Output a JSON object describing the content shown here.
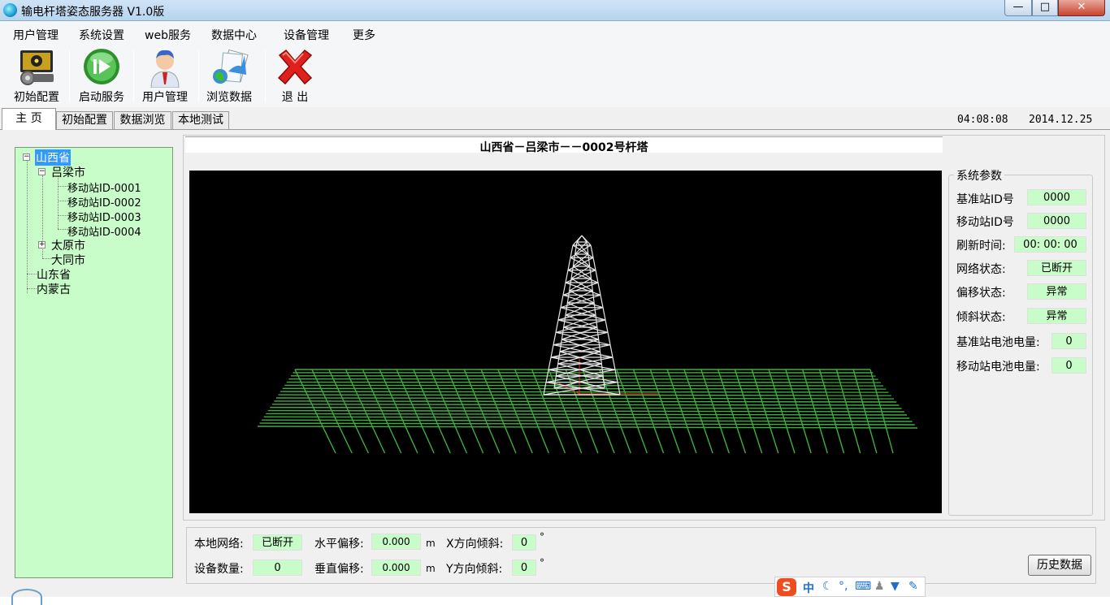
{
  "window": {
    "title": "输电杆塔姿态服务器  V1.0版",
    "controls": {
      "minimize": "—",
      "maximize": "□",
      "close": "✕"
    }
  },
  "menu": [
    "用户管理",
    "系统设置",
    "web服务",
    "数据中心",
    "设备管理",
    "更多"
  ],
  "toolbar": [
    {
      "label": "初始配置",
      "icon": "monitor-gear-icon"
    },
    {
      "label": "启动服务",
      "icon": "play-circle-icon"
    },
    {
      "label": "用户管理",
      "icon": "user-avatar-icon"
    },
    {
      "label": "浏览数据",
      "icon": "browse-document-icon"
    },
    {
      "label": "退 出",
      "icon": "red-x-exit-icon"
    }
  ],
  "tabs": [
    "主 页",
    "初始配置",
    "数据浏览",
    "本地测试"
  ],
  "clock": "04:08:08",
  "date": "2014.12.25",
  "tree": {
    "root": "山西省",
    "city1": "吕梁市",
    "stations": [
      "移动站ID-0001",
      "移动站ID-0002",
      "移动站ID-0003",
      "移动站ID-0004"
    ],
    "city2": "太原市",
    "city3": "大同市",
    "province2": "山东省",
    "province3": "内蒙古"
  },
  "viewer": {
    "title": "山西省－吕梁市－－0002号杆塔",
    "colors": {
      "background": "#000000",
      "grid": "#3fae3f",
      "tower": "#e6e6e6",
      "axis": "#cc2a2a"
    }
  },
  "params": {
    "legend": "系统参数",
    "rows": [
      {
        "label": "基准站ID号",
        "value": "0000"
      },
      {
        "label": "移动站ID号",
        "value": "0000"
      },
      {
        "label": "刷新时间:",
        "value": "00: 00: 00"
      },
      {
        "label": "网络状态:",
        "value": "已断开"
      },
      {
        "label": "偏移状态:",
        "value": "异常"
      },
      {
        "label": "倾斜状态:",
        "value": "异常"
      },
      {
        "label": "基准站电池电量:",
        "value": "0"
      },
      {
        "label": "移动站电池电量:",
        "value": "0"
      }
    ]
  },
  "status": {
    "network_label": "本地网络:",
    "network_value": "已断开",
    "devices_label": "设备数量:",
    "devices_value": "0",
    "hshift_label": "水平偏移:",
    "hshift_value": "0.000",
    "hshift_unit": "m",
    "vshift_label": "垂直偏移:",
    "vshift_value": "0.000",
    "vshift_unit": "m",
    "xtilt_label": "X方向倾斜:",
    "xtilt_value": "0",
    "xtilt_unit": "°",
    "ytilt_label": "Y方向倾斜:",
    "ytilt_value": "0",
    "ytilt_unit": "°",
    "history_button": "历史数据"
  },
  "ime": {
    "logo": "S",
    "lang": "中"
  }
}
